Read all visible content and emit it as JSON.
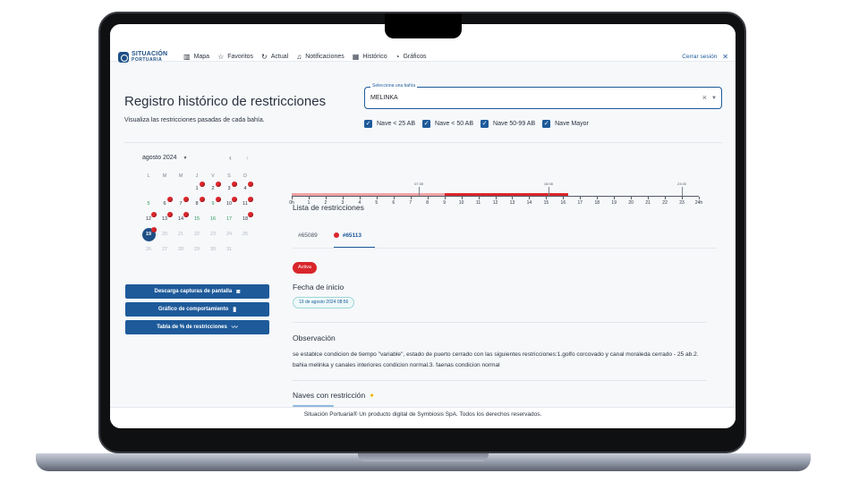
{
  "brand": {
    "line1": "SITUACIÓN",
    "line2": "PORTUARIA"
  },
  "nav": [
    {
      "label": "Mapa",
      "icon": "map-icon"
    },
    {
      "label": "Favoritos",
      "icon": "star-icon"
    },
    {
      "label": "Actual",
      "icon": "refresh-icon"
    },
    {
      "label": "Notificaciones",
      "icon": "bell-icon"
    },
    {
      "label": "Histórico",
      "icon": "calendar-icon"
    },
    {
      "label": "Gráficos",
      "icon": "pie-chart-icon"
    }
  ],
  "logout": "Cerrar sesión",
  "page": {
    "title": "Registro histórico de restricciones",
    "subtitle": "Visualiza las restricciones pasadas de cada bahía."
  },
  "bay_select": {
    "label": "Selecciona una bahía",
    "value": "MELINKA"
  },
  "vessel_filters": [
    {
      "label": "Nave < 25 AB",
      "checked": true
    },
    {
      "label": "Nave < 50 AB",
      "checked": true
    },
    {
      "label": "Nave 50-99 AB",
      "checked": true
    },
    {
      "label": "Nave Mayor",
      "checked": true
    }
  ],
  "calendar": {
    "month_label": "agosto 2024",
    "weekdays": [
      "L",
      "M",
      "M",
      "J",
      "V",
      "S",
      "D"
    ],
    "weeks": [
      [
        {
          "d": ""
        },
        {
          "d": ""
        },
        {
          "d": ""
        },
        {
          "d": "1",
          "dot": true
        },
        {
          "d": "2",
          "dot": true
        },
        {
          "d": "3",
          "dot": true
        },
        {
          "d": "4",
          "dot": true
        }
      ],
      [
        {
          "d": "5",
          "g": true
        },
        {
          "d": "6",
          "dot": true
        },
        {
          "d": "7",
          "dot": true
        },
        {
          "d": "8",
          "dot": true
        },
        {
          "d": "9",
          "dot": true,
          "g": true
        },
        {
          "d": "10",
          "dot": true
        },
        {
          "d": "11",
          "dot": true
        }
      ],
      [
        {
          "d": "12",
          "dot": true
        },
        {
          "d": "13",
          "dot": true
        },
        {
          "d": "14",
          "dot": true
        },
        {
          "d": "15",
          "g": true
        },
        {
          "d": "16",
          "g": true
        },
        {
          "d": "17",
          "g": true
        },
        {
          "d": "18",
          "dot": true
        }
      ],
      [
        {
          "d": "19",
          "sel": true,
          "dot": true
        },
        {
          "d": "20",
          "m": true
        },
        {
          "d": "21",
          "m": true
        },
        {
          "d": "22",
          "m": true
        },
        {
          "d": "23",
          "m": true
        },
        {
          "d": "24",
          "m": true
        },
        {
          "d": "25",
          "m": true
        }
      ],
      [
        {
          "d": "26",
          "m": true
        },
        {
          "d": "27",
          "m": true
        },
        {
          "d": "28",
          "m": true
        },
        {
          "d": "29",
          "m": true
        },
        {
          "d": "30",
          "m": true
        },
        {
          "d": "31",
          "m": true
        },
        {
          "d": ""
        }
      ]
    ]
  },
  "actions": {
    "screenshots": "Descarga capturas de pantalla",
    "behavior_chart": "Gráfico de comportamiento",
    "percent_table": "Tabla de % de restricciones"
  },
  "timeline": {
    "hours": [
      "0h",
      "1",
      "2",
      "3",
      "4",
      "5",
      "6",
      "7",
      "8",
      "9",
      "10",
      "11",
      "12",
      "13",
      "14",
      "15",
      "16",
      "17",
      "18",
      "19",
      "20",
      "21",
      "22",
      "23",
      "24h"
    ],
    "segments": [
      {
        "from": 0,
        "to": 9,
        "color": "#f0a2a5"
      },
      {
        "from": 9,
        "to": 16.3,
        "color": "#d9262b"
      }
    ],
    "markers": [
      {
        "at": 7.5,
        "label": "07:30"
      },
      {
        "at": 15.13,
        "label": "15:08"
      },
      {
        "at": 23.0,
        "label": "23:00"
      }
    ]
  },
  "restrictions": {
    "section_title": "Lista de restricciones",
    "tabs": [
      {
        "label": "#65089",
        "active": false,
        "dot": false
      },
      {
        "label": "#65113",
        "active": true,
        "dot": true
      }
    ],
    "status": "Activa",
    "start_title": "Fecha de inicio",
    "start_date": "19 de agosto 2024 08:56",
    "observation_title": "Observación",
    "observation": "se establce condicion de tiempo \"variable\", estado de puerto cerrado con las siguientes restricciones:1.golfo corcovado y canal moraleda cerrado - 25 ab.2. bahia melinka y canales interiores condicion normal.3. faenas condicion normal",
    "vessels_title": "Naves con restricción"
  },
  "footer": "Situación Portuaria® Un producto digital de Symbiosis SpA. Todos los derechos reservados."
}
